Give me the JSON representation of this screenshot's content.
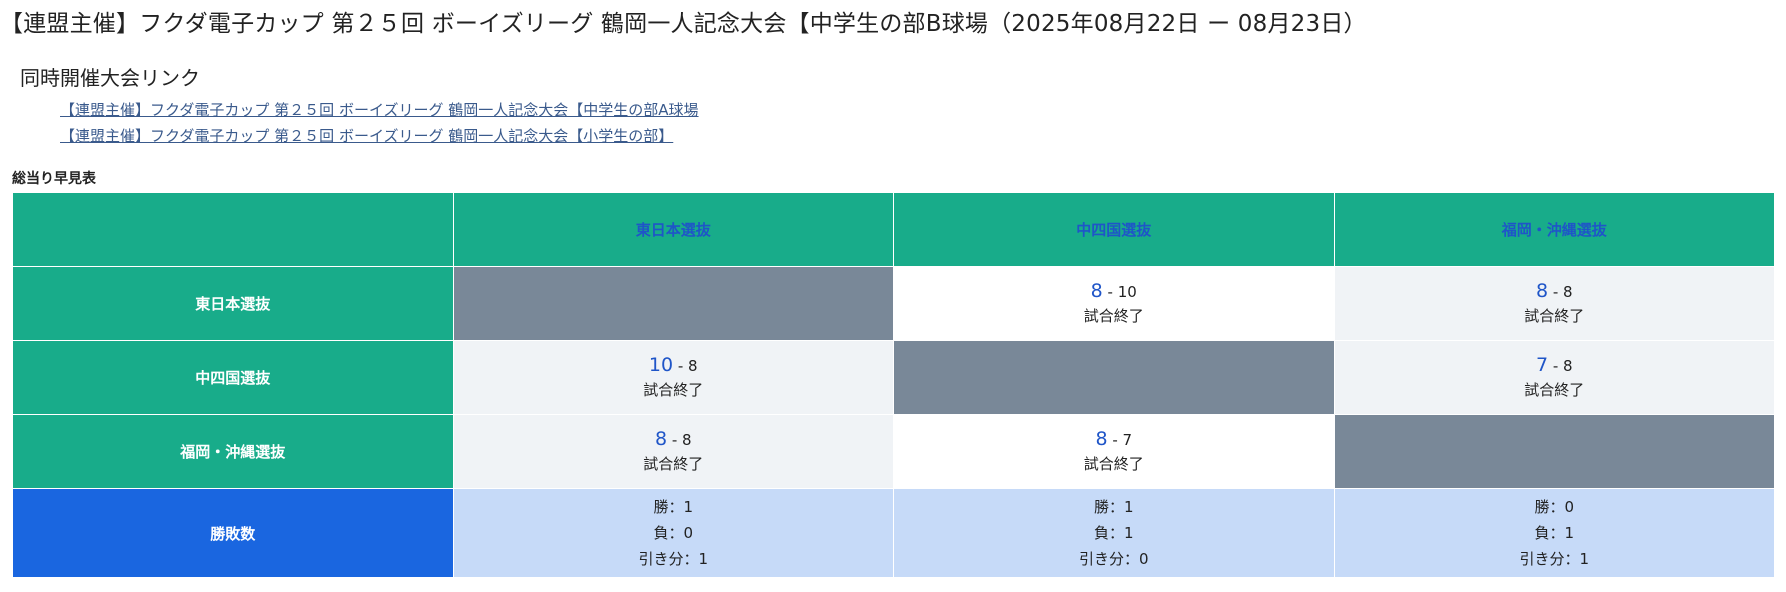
{
  "page_title": "【連盟主催】フクダ電子カップ 第２５回 ボーイズリーグ 鶴岡一人記念大会【中学生の部B球場（2025年08月22日 ー 08月23日）",
  "related": {
    "heading": "同時開催大会リンク",
    "links": [
      "【連盟主催】フクダ電子カップ 第２５回 ボーイズリーグ 鶴岡一人記念大会【中学生の部A球場",
      "【連盟主催】フクダ電子カップ 第２５回 ボーイズリーグ 鶴岡一人記念大会【小学生の部】"
    ]
  },
  "table": {
    "caption": "総当り早見表",
    "teams": [
      "東日本選抜",
      "中四国選抜",
      "福岡・沖縄選抜"
    ],
    "results": {
      "r0c1": {
        "for": "8",
        "sep": " - ",
        "against": "10",
        "status": "試合終了"
      },
      "r0c2": {
        "for": "8",
        "sep": " - ",
        "against": "8",
        "status": "試合終了"
      },
      "r1c0": {
        "for": "10",
        "sep": " - ",
        "against": "8",
        "status": "試合終了"
      },
      "r1c2": {
        "for": "7",
        "sep": " - ",
        "against": "8",
        "status": "試合終了"
      },
      "r2c0": {
        "for": "8",
        "sep": " - ",
        "against": "8",
        "status": "試合終了"
      },
      "r2c1": {
        "for": "8",
        "sep": " - ",
        "against": "7",
        "status": "試合終了"
      }
    },
    "record_label": "勝敗数",
    "records": [
      {
        "win": "勝：1",
        "loss": "負：0",
        "draw": "引き分：1"
      },
      {
        "win": "勝：1",
        "loss": "負：1",
        "draw": "引き分：0"
      },
      {
        "win": "勝：0",
        "loss": "負：1",
        "draw": "引き分：1"
      }
    ]
  }
}
